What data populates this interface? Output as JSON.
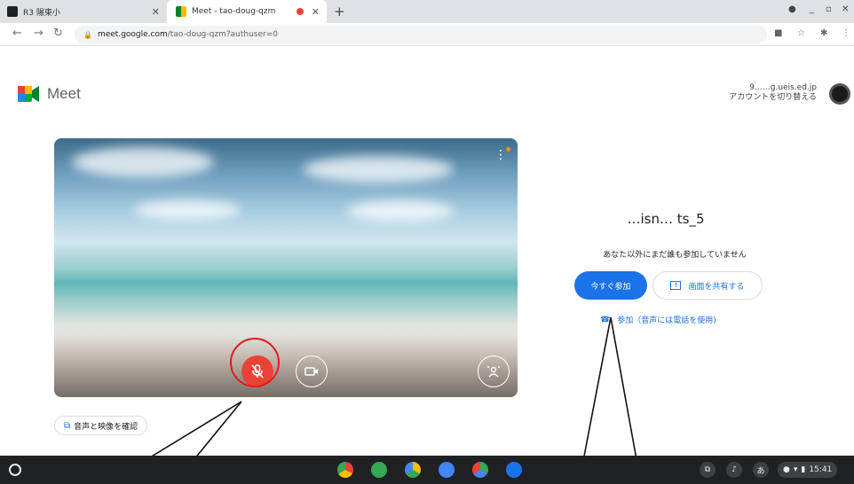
{
  "browser": {
    "tabs": [
      {
        "title": "R3  陽東小",
        "active": false
      },
      {
        "title": "Meet - tao-doug-qzm",
        "active": true
      }
    ],
    "new_tab": "+",
    "url_domain": "meet.google.com",
    "url_path": "/tao-doug-qzm?authuser=0"
  },
  "meet": {
    "logo_text": "Meet",
    "account_email": "9……g.ueis.ed.jp",
    "switch_account": "アカウントを切り替える",
    "meeting_code": "…isn… ts_5",
    "nobody_here": "あなた以外にまだ誰も参加していません",
    "join_now": "今すぐ参加",
    "present": "画面を共有する",
    "join_phone": "参加（音声には電話を使用)",
    "check_av": "音声と映像を確認"
  },
  "shelf": {
    "clock": "15:41",
    "ime": "あ"
  },
  "colors": {
    "accent": "#1a73e8",
    "mic_off": "#ea4335",
    "annotation": "#e01b1b"
  }
}
